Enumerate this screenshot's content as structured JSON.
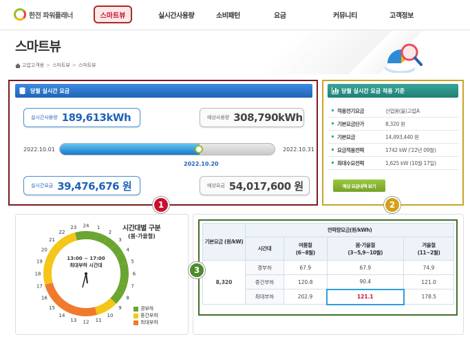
{
  "nav": {
    "logo_text": "한전 파워플래너",
    "active": "스마트뷰",
    "items": [
      "실시간사용량",
      "소비패턴",
      "요금",
      "커뮤니티",
      "고객정보"
    ]
  },
  "page": {
    "title": "스마트뷰",
    "breadcrumb": [
      "고압고객용",
      "스마트뷰",
      "스마트뷰"
    ]
  },
  "realtime": {
    "header": "당월 실시간 요금",
    "usage_label": "실시간사용량",
    "usage_value": "189,613kWh",
    "expected_usage_label": "예상사용량",
    "expected_usage_value": "308,790kWh",
    "date_start": "2022.10.01",
    "date_end": "2022.10.31",
    "date_now": "2022.10.20",
    "progress": 0.645,
    "fee_label": "실시간요금",
    "fee_value": "39,476,676 원",
    "expected_fee_label": "예상요금",
    "expected_fee_value": "54,017,600 원"
  },
  "rate_basis": {
    "header": "당월 실시간 요금 적용 기준",
    "rows": [
      {
        "k": "적용전기요금",
        "v": "산업용(을)고압A"
      },
      {
        "k": "기본요금단가",
        "v": "8,320 원"
      },
      {
        "k": "기본요금",
        "v": "14,493,440 원"
      },
      {
        "k": "요금적용전력",
        "v": "1742 kW ('22년 09월)"
      },
      {
        "k": "최대수요전력",
        "v": "1,625 kW (10월 17일)"
      }
    ],
    "button": "예상 요금내역 보기"
  },
  "time_of_day": {
    "title": "시간대별 구분",
    "subtitle": "(봄·가을철)",
    "center_time": "13:00 ~ 17:00",
    "center_label": "최대부하 시간대",
    "hours": [
      24,
      1,
      2,
      3,
      4,
      5,
      6,
      7,
      8,
      9,
      10,
      11,
      12,
      13,
      14,
      15,
      16,
      17,
      18,
      19,
      20,
      21,
      22,
      23
    ],
    "load_by_hour": [
      "light",
      "light",
      "light",
      "light",
      "light",
      "light",
      "light",
      "light",
      "light",
      "mid",
      "mid",
      "max",
      "max",
      "max",
      "max",
      "max",
      "max",
      "mid",
      "mid",
      "mid",
      "mid",
      "mid",
      "mid",
      "light"
    ],
    "legend": [
      {
        "label": "경부하",
        "color": "#6aa531"
      },
      {
        "label": "중간부하",
        "color": "#f5c518"
      },
      {
        "label": "최대부하",
        "color": "#ef7a2c"
      }
    ]
  },
  "badges": [
    "1",
    "2",
    "3"
  ],
  "rate_table": {
    "base_fee_header": "기본요금 (원/kW)",
    "energy_header": "전력량요금(원/kWh)",
    "time_col": "시간대",
    "seasons": [
      {
        "name": "여름철",
        "months": "(6~8월)"
      },
      {
        "name": "봄·가을철",
        "months": "(3~5,9~10월)"
      },
      {
        "name": "겨울철",
        "months": "(11~2월)"
      }
    ],
    "base_fee": "8,320",
    "rows": [
      {
        "time": "경부하",
        "values": [
          "67.9",
          "67.9",
          "74.9"
        ]
      },
      {
        "time": "중간부하",
        "values": [
          "120.8",
          "90.4",
          "121.0"
        ]
      },
      {
        "time": "최대부하",
        "values": [
          "202.9",
          "121.1",
          "178.5"
        ]
      }
    ]
  }
}
